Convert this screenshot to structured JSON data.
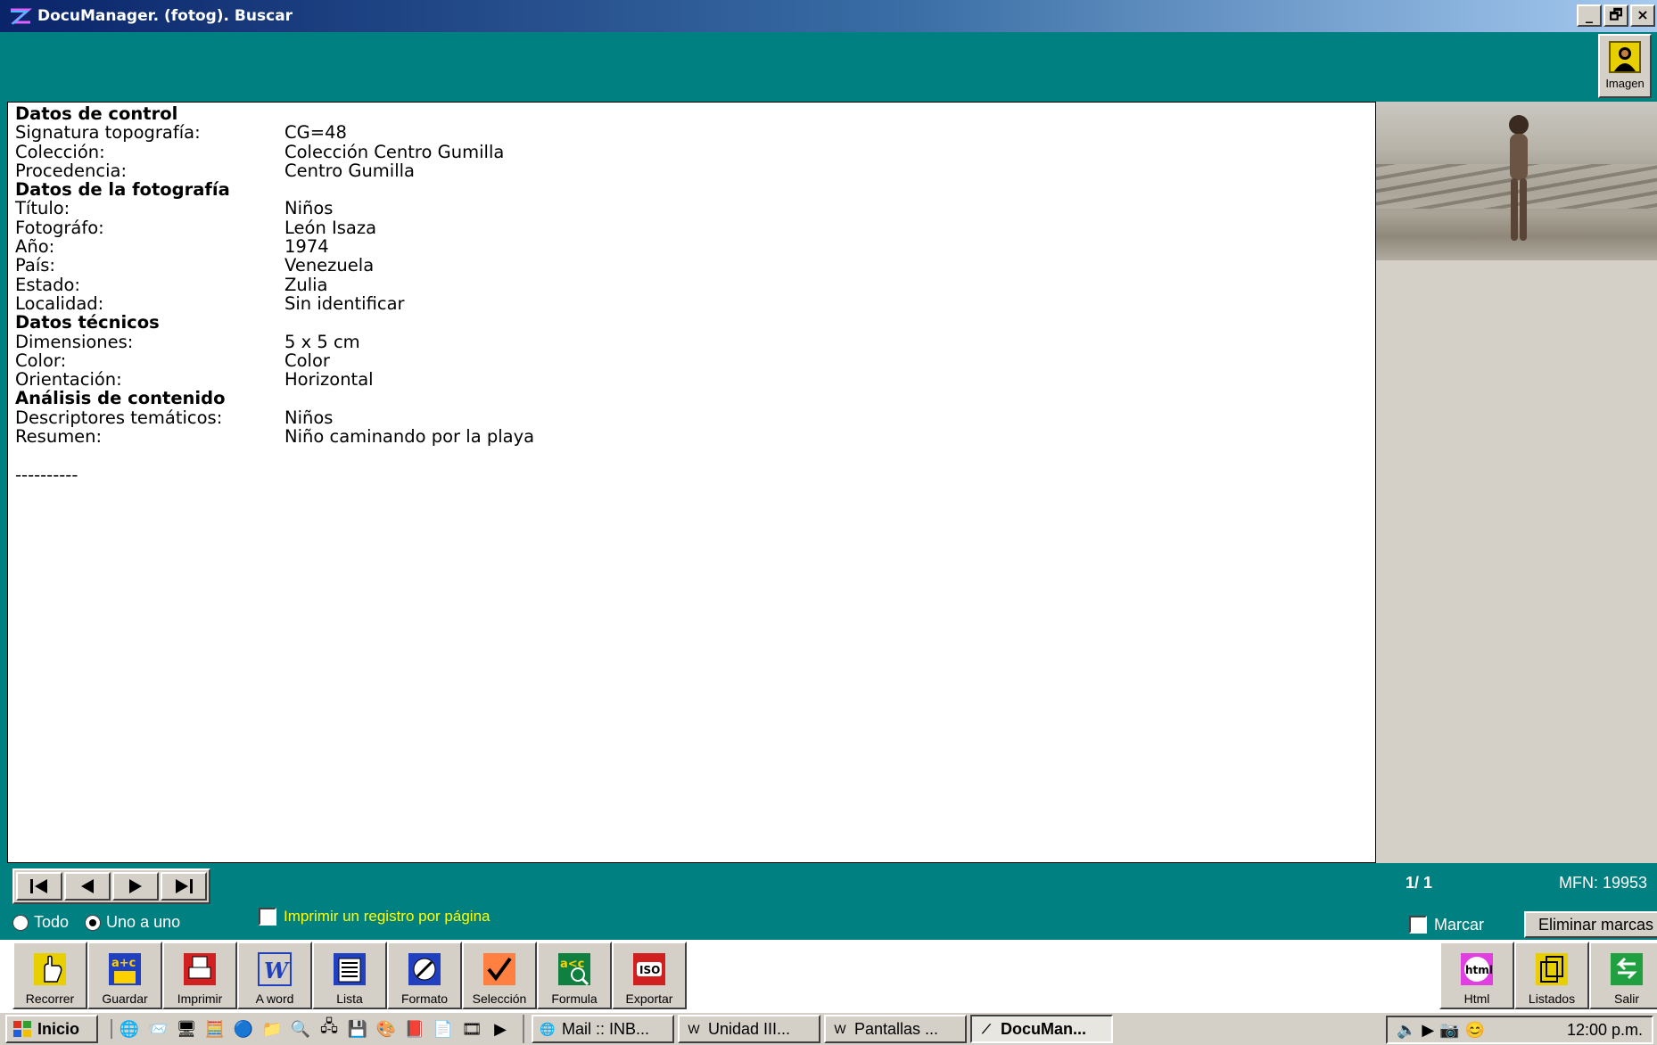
{
  "window": {
    "title": "DocuManager. (fotog). Buscar",
    "controls": [
      "_",
      "🗗",
      "×"
    ]
  },
  "toolbar_top": {
    "imagen_label": "Imagen"
  },
  "record": {
    "sections": [
      {
        "heading": "Datos de control",
        "fields": [
          {
            "label": "Signatura topografía:",
            "value": "CG=48"
          },
          {
            "label": "Colección:",
            "value": "Colección Centro Gumilla"
          },
          {
            "label": "Procedencia:",
            "value": "Centro Gumilla"
          }
        ]
      },
      {
        "heading": "Datos de la fotografía",
        "fields": [
          {
            "label": "Título:",
            "value": "Niños"
          },
          {
            "label": "Fotográfo:",
            "value": "León Isaza"
          },
          {
            "label": "Año:",
            "value": "1974"
          },
          {
            "label": "País:",
            "value": "Venezuela"
          },
          {
            "label": "Estado:",
            "value": "Zulia"
          },
          {
            "label": "Localidad:",
            "value": "Sin identificar"
          }
        ]
      },
      {
        "heading": "Datos técnicos",
        "fields": [
          {
            "label": "Dimensiones:",
            "value": "5 x 5 cm"
          },
          {
            "label": "Color:",
            "value": "Color"
          },
          {
            "label": "Orientación:",
            "value": "Horizontal"
          }
        ]
      },
      {
        "heading": "Análisis de contenido",
        "fields": [
          {
            "label": "Descriptores temáticos:",
            "value": "Niños"
          },
          {
            "label": "Resumen:",
            "value": "Niño caminando por la playa"
          }
        ]
      }
    ],
    "separator": "----------"
  },
  "navigation": {
    "buttons": [
      "first",
      "previous",
      "next",
      "last"
    ],
    "radio_todo": "Todo",
    "radio_uno": "Uno a uno",
    "print_option": "Imprimir un registro por página",
    "counter": "1/ 1",
    "mfn": "MFN: 19953",
    "marcar": "Marcar",
    "eliminar": "Eliminar marcas"
  },
  "tools": [
    {
      "name": "recorrer",
      "label": "Recorrer",
      "icon": "hand-pointer-icon",
      "color": "#e8d000"
    },
    {
      "name": "guardar",
      "label": "Guardar",
      "icon": "abc-save-icon",
      "color": "#2040c0"
    },
    {
      "name": "imprimir",
      "label": "Imprimir",
      "icon": "printer-icon",
      "color": "#d02020"
    },
    {
      "name": "a-word",
      "label": "A word",
      "icon": "word-icon",
      "color": "#2040c0"
    },
    {
      "name": "lista",
      "label": "Lista",
      "icon": "list-icon",
      "color": "#2040c0"
    },
    {
      "name": "formato",
      "label": "Formato",
      "icon": "format-icon",
      "color": "#2040c0"
    },
    {
      "name": "seleccion",
      "label": "Selección",
      "icon": "check-icon",
      "color": "#ff8040"
    },
    {
      "name": "formula",
      "label": "Formula",
      "icon": "formula-icon",
      "color": "#108040"
    },
    {
      "name": "exportar",
      "label": "Exportar",
      "icon": "iso-export-icon",
      "color": "#d02020"
    }
  ],
  "tools_right": [
    {
      "name": "html",
      "label": "Html",
      "icon": "html-icon",
      "color": "#e040e0"
    },
    {
      "name": "listados",
      "label": "Listados",
      "icon": "listados-icon",
      "color": "#e8d000"
    },
    {
      "name": "salir",
      "label": "Salir",
      "icon": "exit-icon",
      "color": "#20a040"
    }
  ],
  "taskbar": {
    "start_label": "Inicio",
    "tasks": [
      {
        "label": "Mail :: INB...",
        "icon": "ie-icon"
      },
      {
        "label": "Unidad III...",
        "icon": "word-doc-icon"
      },
      {
        "label": "Pantallas ...",
        "icon": "word-doc-icon"
      },
      {
        "label": "DocuMan...",
        "icon": "documanager-icon",
        "active": true
      }
    ],
    "clock": "12:00 p.m."
  }
}
